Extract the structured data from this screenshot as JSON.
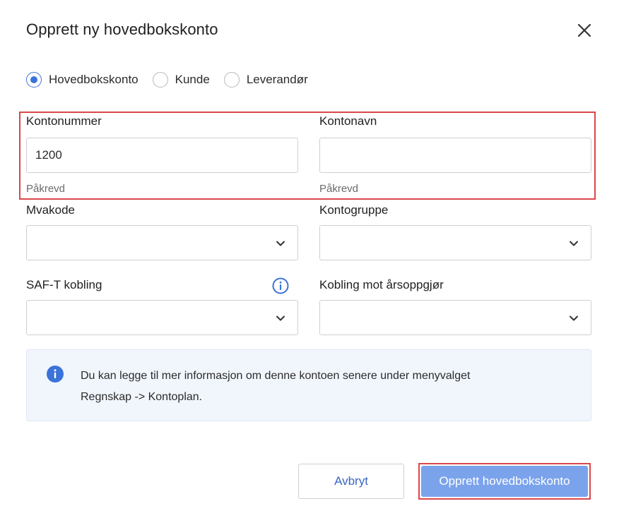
{
  "dialog": {
    "title": "Opprett ny hovedbokskonto",
    "close_icon": "close-icon"
  },
  "account_type": {
    "options": [
      {
        "label": "Hovedbokskonto",
        "selected": true
      },
      {
        "label": "Kunde",
        "selected": false
      },
      {
        "label": "Leverandør",
        "selected": false
      }
    ]
  },
  "fields": {
    "kontonummer": {
      "label": "Kontonummer",
      "value": "1200",
      "hint": "Påkrevd"
    },
    "kontonavn": {
      "label": "Kontonavn",
      "value": "",
      "hint": "Påkrevd"
    },
    "mvakode": {
      "label": "Mvakode",
      "value": ""
    },
    "kontogruppe": {
      "label": "Kontogruppe",
      "value": ""
    },
    "saft": {
      "label": "SAF-T kobling",
      "value": "",
      "info_icon": "info-icon"
    },
    "arsoppgjor": {
      "label": "Kobling mot årsoppgjør",
      "value": ""
    }
  },
  "info": {
    "icon": "info-filled-icon",
    "text_line1": "Du kan legge til mer informasjon om denne kontoen senere under menyvalget",
    "text_line2": "Regnskap -> Kontoplan."
  },
  "buttons": {
    "cancel": "Avbryt",
    "submit": "Opprett hovedbokskonto"
  },
  "colors": {
    "accent": "#3b73d8",
    "primary_button": "#7ba3ec",
    "highlight": "#d9474b",
    "info_bg": "#f1f6fd"
  }
}
